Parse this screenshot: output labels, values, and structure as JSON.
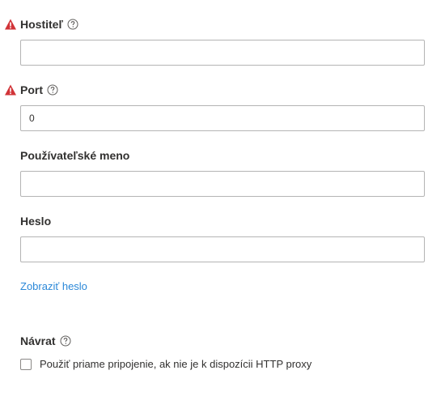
{
  "form": {
    "host": {
      "label": "Hostiteľ",
      "value": "",
      "required": true
    },
    "port": {
      "label": "Port",
      "value": "0",
      "required": true
    },
    "username": {
      "label": "Používateľské meno",
      "value": ""
    },
    "password": {
      "label": "Heslo",
      "value": ""
    },
    "show_password_link": "Zobraziť heslo",
    "fallback": {
      "label": "Návrat",
      "checkbox_label": "Použiť priame pripojenie, ak nie je k dispozícii HTTP proxy",
      "checked": false
    }
  },
  "colors": {
    "warning": "#d13438",
    "link": "#2b88d8",
    "border": "#b4b4b4",
    "text": "#323130"
  },
  "icons": {
    "warning": "warning-triangle-icon",
    "help": "question-circle-icon"
  }
}
